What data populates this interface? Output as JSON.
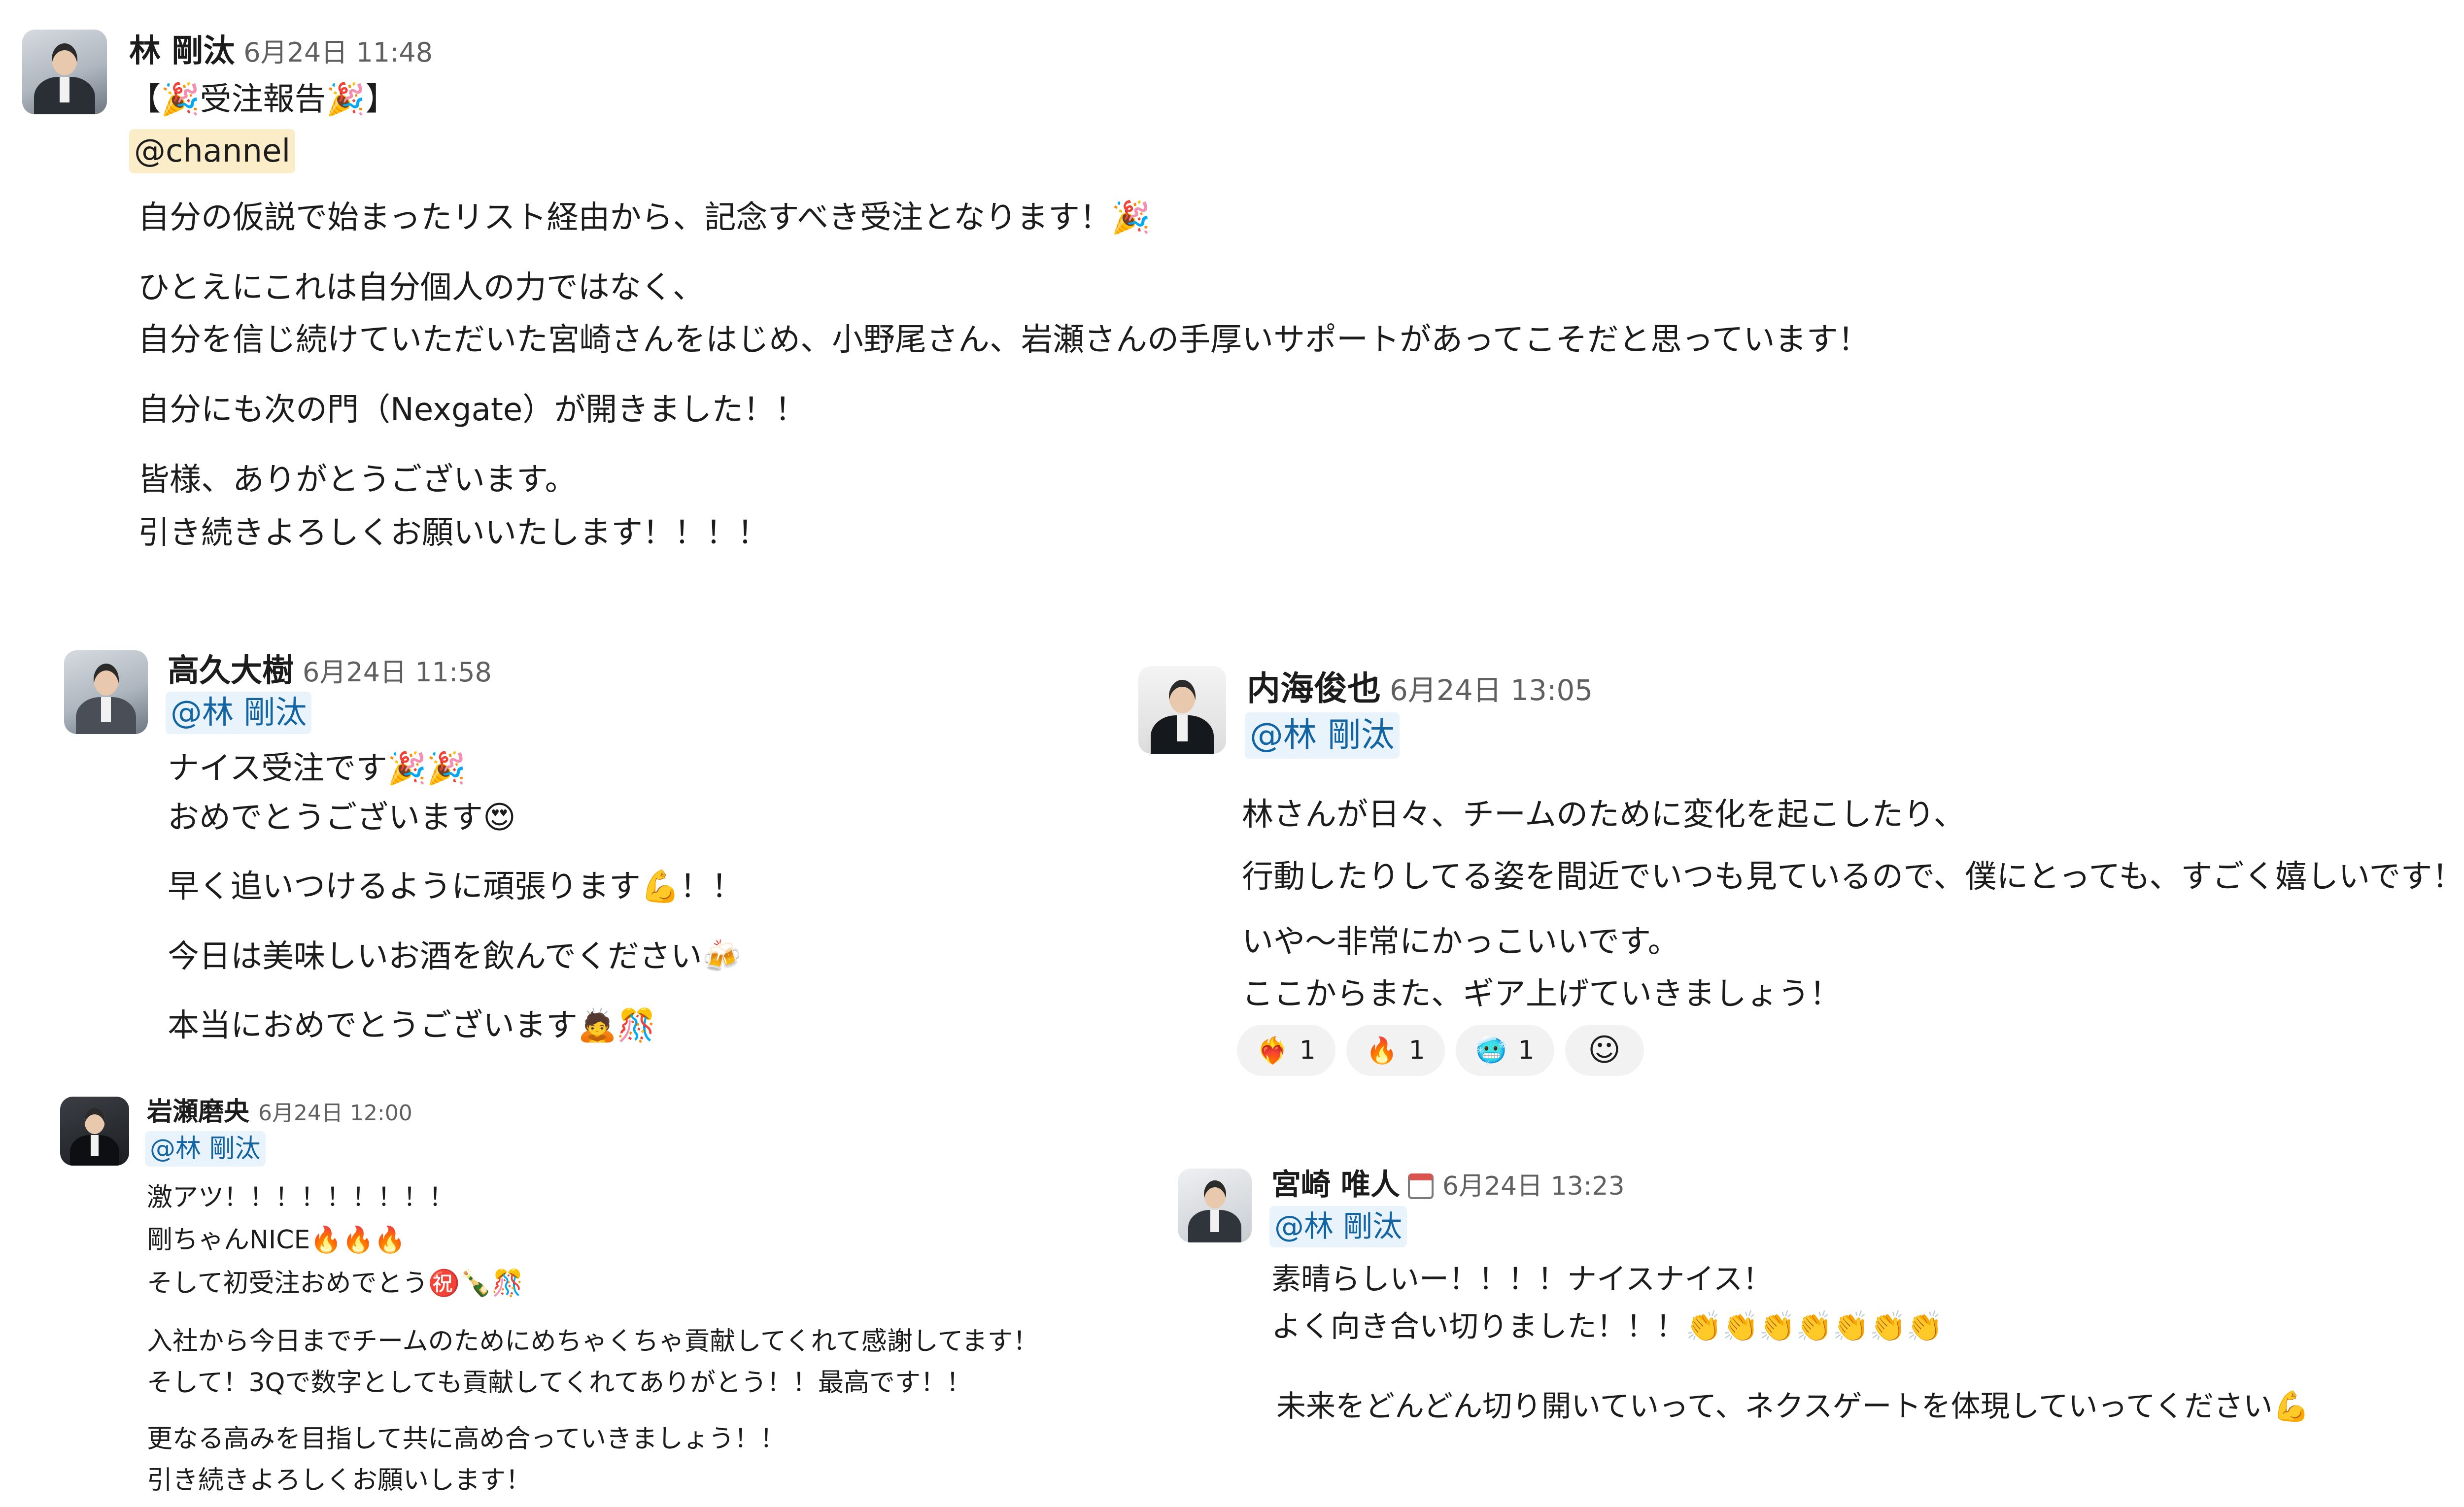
{
  "messages": {
    "m1": {
      "name": "林 剛汰",
      "time": "6月24日 11:48",
      "mention": "@channel",
      "lines": [
        "【🎉受注報告🎉】",
        "自分の仮説で始まったリスト経由から、記念すべき受注となります！🎉",
        "ひとえにこれは自分個人の力ではなく、",
        "自分を信じ続けていただいた宮崎さんをはじめ、小野尾さん、岩瀬さんの手厚いサポートがあってこそだと思っています！",
        "自分にも次の門（Nexgate）が開きました！！",
        "皆様、ありがとうございます。",
        "引き続きよろしくお願いいたします！！！！"
      ]
    },
    "m2": {
      "name": "高久大樹",
      "time": "6月24日 11:58",
      "mention": "@林 剛汰",
      "lines": [
        "ナイス受注です🎉🎉",
        "おめでとうございます😍",
        "早く追いつけるように頑張ります💪！！",
        "今日は美味しいお酒を飲んでください🍻",
        "本当におめでとうございます🙇🎊"
      ]
    },
    "m3": {
      "name": "内海俊也",
      "time": "6月24日 13:05",
      "mention": "@林 剛汰",
      "lines": [
        "林さんが日々、チームのために変化を起こしたり、",
        "行動したりしてる姿を間近でいつも見ているので、僕にとっても、すごく嬉しいです！",
        "いや〜非常にかっこいいです。",
        "ここからまた、ギア上げていきましょう！"
      ],
      "reactions": [
        {
          "icon": "❤️‍🔥",
          "count": "1"
        },
        {
          "icon": "🔥",
          "count": "1"
        },
        {
          "icon": "🥶",
          "count": "1"
        }
      ],
      "add_reaction_icon": "☺"
    },
    "m4": {
      "name": "岩瀬磨央",
      "time": "6月24日 12:00",
      "mention": "@林 剛汰",
      "lines": [
        "激アツ！！！！！！！！！",
        "剛ちゃんNICE🔥🔥🔥",
        "そして初受注おめでとう㊗️🍾🎊",
        "入社から今日までチームのためにめちゃくちゃ貢献してくれて感謝してます！",
        "そして！3Qで数字としても貢献してくれてありがとう！！最高です！！",
        "更なる高みを目指して共に高め合っていきましょう！！",
        "引き続きよろしくお願いします！"
      ]
    },
    "m5": {
      "name": "宮崎 唯人",
      "time": "6月24日 13:23",
      "mention": "@林 剛汰",
      "lines": [
        "素晴らしいー！！！！ナイスナイス！",
        "よく向き合い切りました！！！👏👏👏👏👏👏👏",
        "未来をどんどん切り開いていって、ネクスゲートを体現していってください💪"
      ]
    }
  }
}
